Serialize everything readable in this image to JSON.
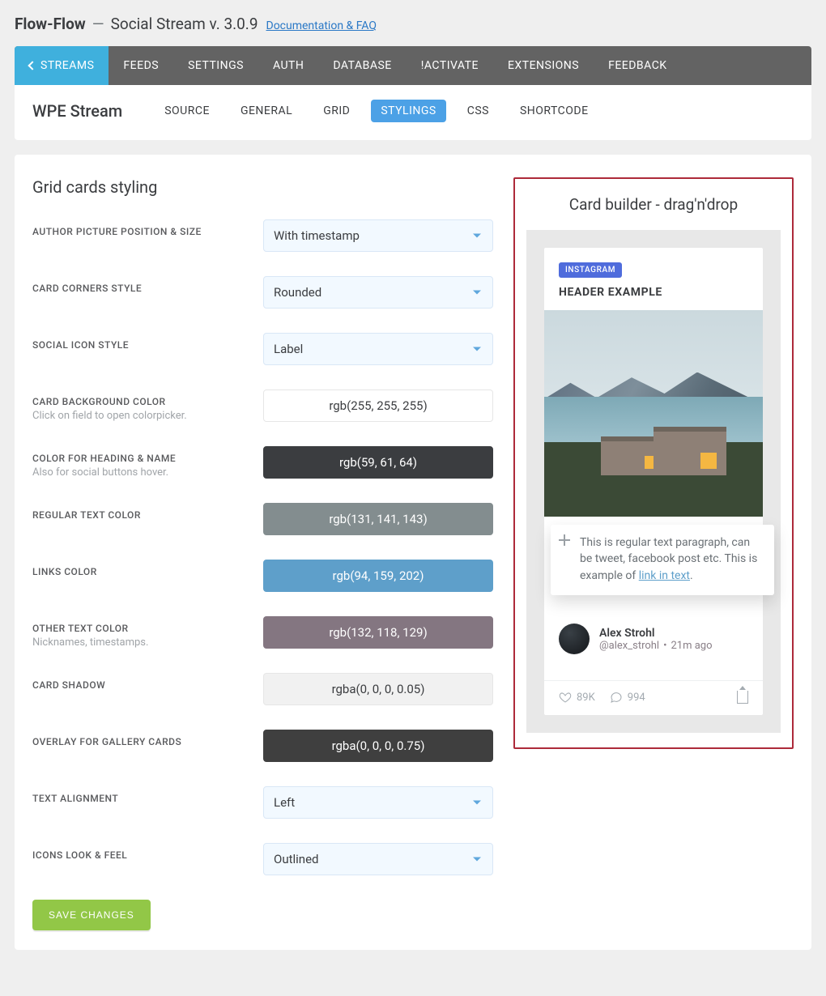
{
  "header": {
    "app": "Flow-Flow",
    "subtitle": "Social Stream v. 3.0.9",
    "doc_link": "Documentation & FAQ"
  },
  "nav": {
    "streams": "STREAMS",
    "feeds": "FEEDS",
    "settings": "SETTINGS",
    "auth": "AUTH",
    "database": "DATABASE",
    "activate": "!ACTIVATE",
    "extensions": "EXTENSIONS",
    "feedback": "FEEDBACK"
  },
  "subbar": {
    "stream_name": "WPE Stream",
    "tabs": {
      "source": "SOURCE",
      "general": "GENERAL",
      "grid": "GRID",
      "stylings": "STYLINGS",
      "css": "CSS",
      "shortcode": "SHORTCODE"
    }
  },
  "form": {
    "title": "Grid cards styling",
    "rows": {
      "author_pic": {
        "label": "AUTHOR PICTURE POSITION & SIZE",
        "value": "With timestamp"
      },
      "corners": {
        "label": "CARD CORNERS STYLE",
        "value": "Rounded"
      },
      "icon_style": {
        "label": "SOCIAL ICON STYLE",
        "value": "Label"
      },
      "bg_color": {
        "label": "CARD BACKGROUND COLOR",
        "hint": "Click on field to open colorpicker.",
        "value": "rgb(255, 255, 255)"
      },
      "heading": {
        "label": "COLOR FOR HEADING & NAME",
        "hint": "Also for social buttons hover.",
        "value": "rgb(59, 61, 64)"
      },
      "regular": {
        "label": "REGULAR TEXT COLOR",
        "value": "rgb(131, 141, 143)"
      },
      "links": {
        "label": "LINKS COLOR",
        "value": "rgb(94, 159, 202)"
      },
      "other": {
        "label": "OTHER TEXT COLOR",
        "hint": "Nicknames, timestamps.",
        "value": "rgb(132, 118, 129)"
      },
      "shadow": {
        "label": "CARD SHADOW",
        "value": "rgba(0, 0, 0, 0.05)"
      },
      "overlay": {
        "label": "OVERLAY FOR GALLERY CARDS",
        "value": "rgba(0, 0, 0, 0.75)"
      },
      "text_align": {
        "label": "TEXT ALIGNMENT",
        "value": "Left"
      },
      "icons_look": {
        "label": "ICONS LOOK & FEEL",
        "value": "Outlined"
      }
    },
    "save": "SAVE CHANGES"
  },
  "preview": {
    "title": "Card builder - drag'n'drop",
    "badge": "INSTAGRAM",
    "heading": "HEADER EXAMPLE",
    "body_prefix": "This is regular text paragraph, can be tweet, facebook post etc. This is example of ",
    "body_link": "link in text",
    "author_name": "Alex Strohl",
    "author_handle": "@alex_strohl",
    "timestamp": "21m ago",
    "likes": "89K",
    "comments": "994"
  },
  "colors": {
    "bg_color": {
      "bg": "#ffffff",
      "fg": "#3b3d40",
      "border": "#e6e6e6"
    },
    "heading": {
      "bg": "#3b3d40",
      "fg": "#ffffff",
      "border": "#3b3d40"
    },
    "regular": {
      "bg": "#838d8f",
      "fg": "#ffffff",
      "border": "#838d8f"
    },
    "links": {
      "bg": "#5e9fca",
      "fg": "#ffffff",
      "border": "#5e9fca"
    },
    "other": {
      "bg": "#847681",
      "fg": "#ffffff",
      "border": "#847681"
    },
    "shadow": {
      "bg": "#f1f1f1",
      "fg": "#3b3d40",
      "border": "#e6e6e6"
    },
    "overlay": {
      "bg": "#3f3f3f",
      "fg": "#ffffff",
      "border": "#3f3f3f"
    }
  }
}
